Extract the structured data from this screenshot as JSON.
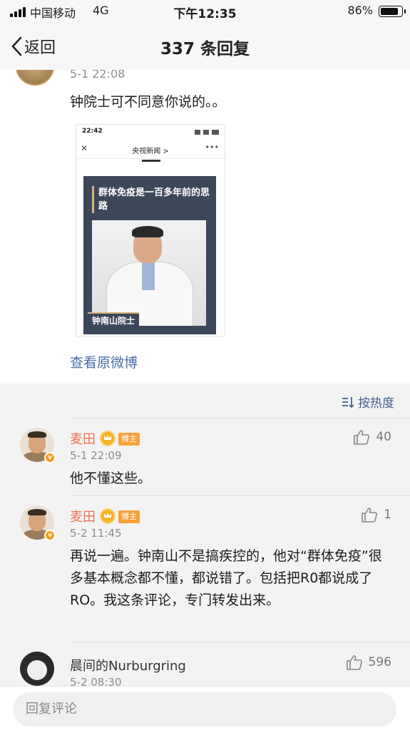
{
  "status_bar": {
    "carrier": "中国移动",
    "network": "4G",
    "time": "下午12:35",
    "battery_percent": "86%",
    "battery_level": 0.86
  },
  "nav": {
    "back_label": "返回",
    "title": "337 条回复"
  },
  "post": {
    "time": "5-1 22:08",
    "text": "钟院士可不同意你说的。。",
    "image": {
      "status_time": "22:42",
      "nav_title": "央视新闻 >",
      "headline": "群体免疫是一百多年前的思路",
      "name_tag": "钟南山院士"
    },
    "view_original_label": "查看原微博"
  },
  "sort": {
    "label": "按热度"
  },
  "comments": [
    {
      "name": "麦田",
      "owner_badge": "博主",
      "time": "5-1 22:09",
      "text": "他不懂这些。",
      "likes": "40"
    },
    {
      "name": "麦田",
      "owner_badge": "博主",
      "time": "5-2 11:45",
      "text": "再说一遍。钟南山不是搞疾控的，他对“群体免疫”很多基本概念都不懂，都说错了。包括把R0都说成了RO。我这条评论，专门转发出来。",
      "likes": "1"
    },
    {
      "name": "晨间的Nurburgring",
      "time": "5-2 08:30",
      "likes": "596"
    }
  ],
  "reply": {
    "placeholder": "回复评论"
  },
  "colors": {
    "accent_link": "#4a6ea5",
    "name_orange": "#eb7350",
    "badge_orange": "#f7a13c"
  }
}
